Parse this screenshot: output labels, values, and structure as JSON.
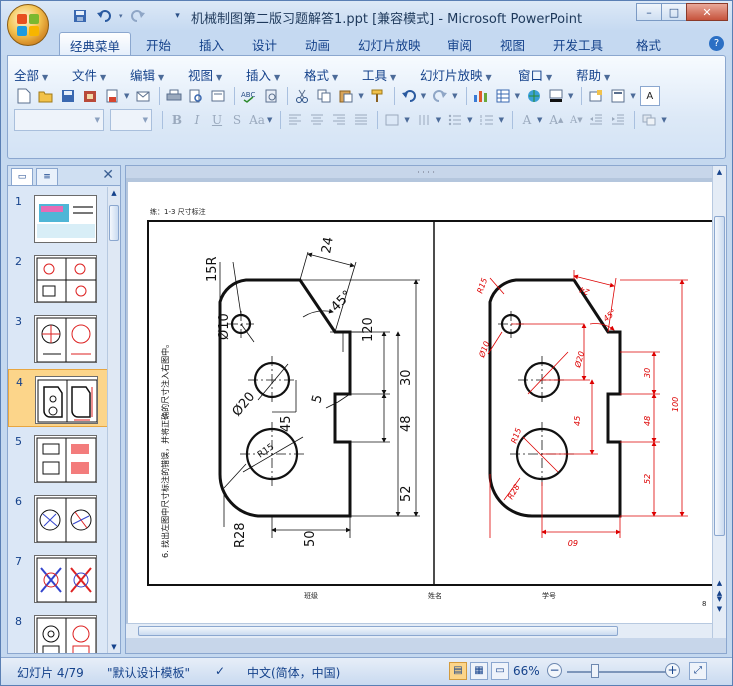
{
  "window": {
    "title": "机械制图第二版习题解答1.ppt [兼容模式] - Microsoft PowerPoint",
    "controls": {
      "minimize": "–",
      "maximize": "□",
      "close": "✕"
    }
  },
  "quick_access": [
    "save-icon",
    "undo-icon",
    "redo-icon",
    "customize-icon"
  ],
  "tabs": [
    "经典菜单",
    "开始",
    "插入",
    "设计",
    "动画",
    "幻灯片放映",
    "审阅",
    "视图",
    "开发工具",
    "格式"
  ],
  "active_tab": "经典菜单",
  "classic_menu": [
    "全部",
    "文件",
    "编辑",
    "视图",
    "插入",
    "格式",
    "工具",
    "幻灯片放映",
    "窗口",
    "帮助"
  ],
  "toolbar_icons_row1": [
    "new-icon",
    "open-icon",
    "save-icon",
    "permission-icon",
    "print-preview-icon",
    "email-icon",
    "print-icon",
    "preview-icon",
    "print2-icon",
    "spelling-icon",
    "research-icon",
    "cut-icon",
    "copy-icon",
    "paste-icon",
    "format-painter-icon",
    "undo-icon",
    "redo-icon",
    "insert-chart-icon",
    "insert-table-icon",
    "hyperlink-icon",
    "fill-color-icon",
    "new-slide-icon",
    "layout-icon",
    "text-icon"
  ],
  "format_row": {
    "bold": "B",
    "italic": "I",
    "underline": "U",
    "strike": "S",
    "case": "Aa"
  },
  "slides_pane": {
    "slide_numbers": [
      "1",
      "2",
      "3",
      "4",
      "5",
      "6",
      "7",
      "8"
    ],
    "selected": "4"
  },
  "slide_content": {
    "header": "练：1-3   尺寸标注",
    "footer_left": "班级",
    "footer_mid": "姓名",
    "footer_right": "学号",
    "page_no": "8",
    "instruction": "6. 找出左图中尺寸标注的错误，并将正确的尺寸注入右图中。",
    "left_dims": [
      "15R",
      "24",
      "45°",
      "120",
      "Ø10",
      "Ø20",
      "45",
      "5",
      "30",
      "48",
      "R15",
      "52",
      "R28",
      "50"
    ],
    "right_dims": [
      "R15",
      "24",
      "45°",
      "Ø10",
      "Ø20",
      "30",
      "45",
      "48",
      "100",
      "R15",
      "52",
      "R28",
      "60"
    ]
  },
  "status": {
    "slide": "幻灯片 4/79",
    "theme": "\"默认设计模板\"",
    "language": "中文(简体，中国)",
    "zoom": "66%",
    "zoom_level": 0.66
  }
}
